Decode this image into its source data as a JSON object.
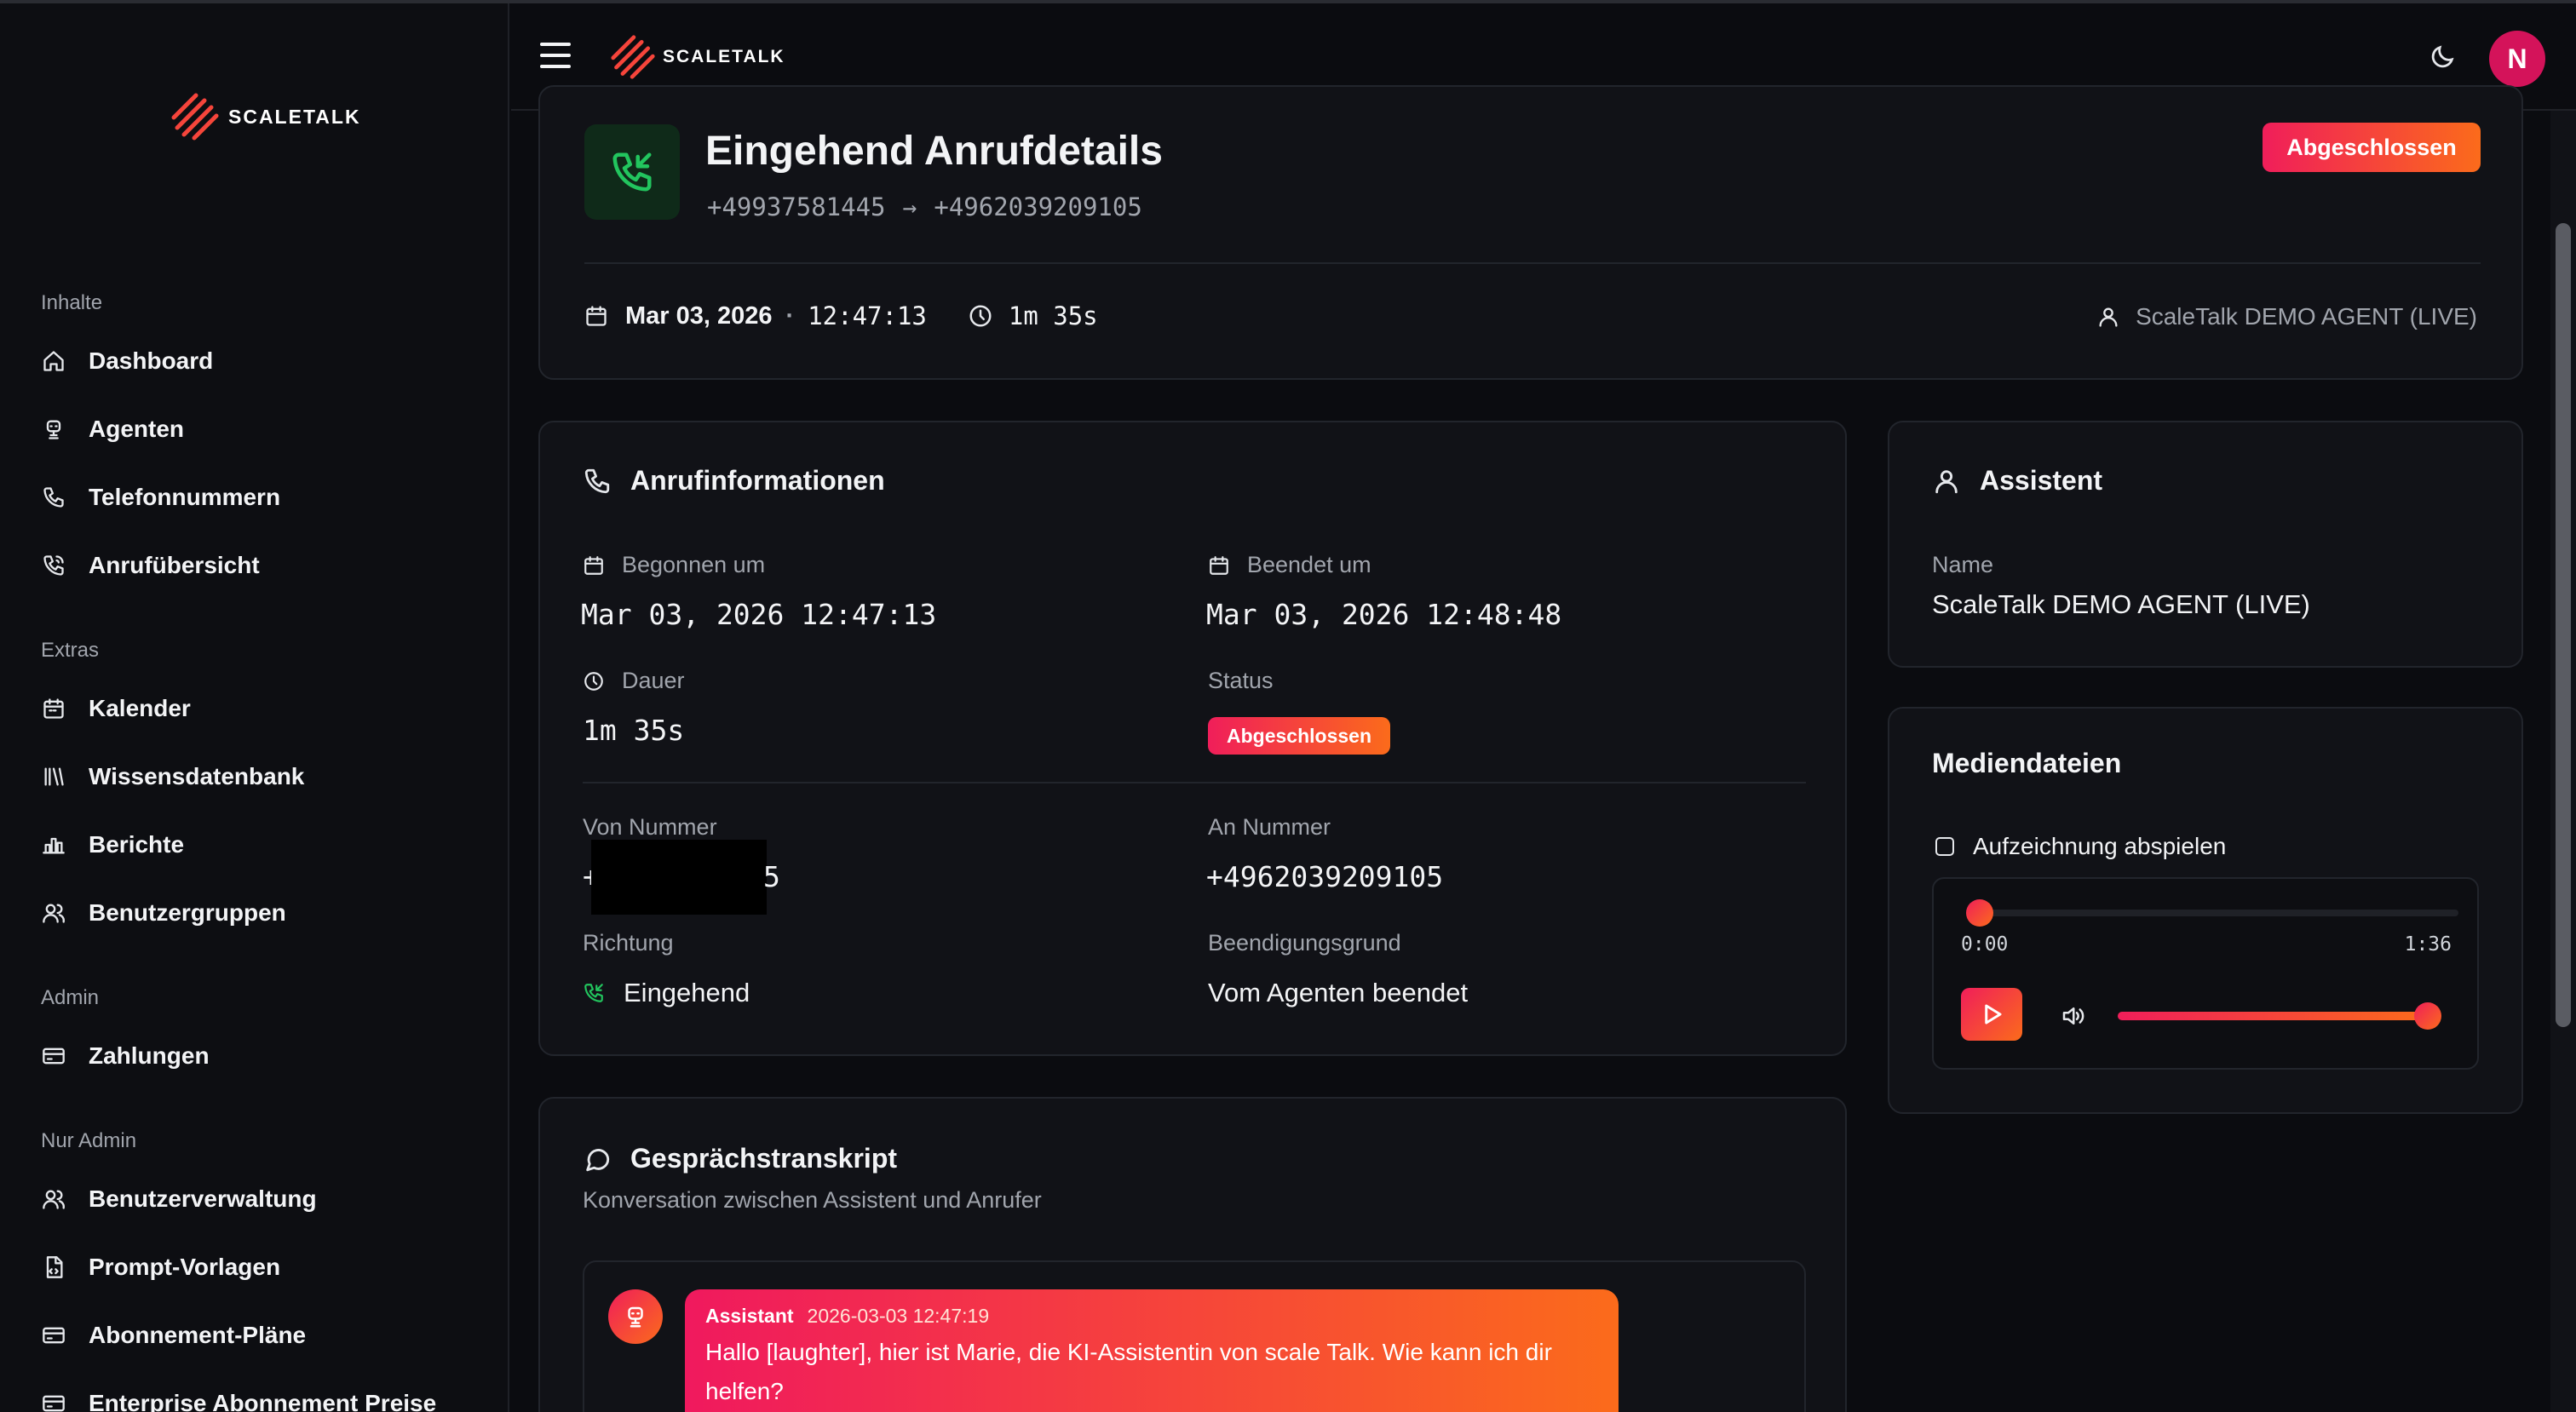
{
  "brand": {
    "name": "SCALETALK"
  },
  "sidebar": {
    "sections": [
      {
        "label": "Inhalte",
        "items": [
          "Dashboard",
          "Agenten",
          "Telefonnummern",
          "Anrufübersicht"
        ]
      },
      {
        "label": "Extras",
        "items": [
          "Kalender",
          "Wissensdatenbank",
          "Berichte",
          "Benutzergruppen"
        ]
      },
      {
        "label": "Admin",
        "items": [
          "Zahlungen"
        ]
      },
      {
        "label": "Nur Admin",
        "items": [
          "Benutzerverwaltung",
          "Prompt-Vorlagen",
          "Abonnement-Pläne",
          "Enterprise Abonnement Preise"
        ]
      }
    ]
  },
  "header": {
    "avatar_initial": "N"
  },
  "call": {
    "title": "Eingehend Anrufdetails",
    "from_number": "+49937581445",
    "to_number": "+4962039209105",
    "date": "Mar 03, 2026",
    "time": "12:47:13",
    "duration": "1m 35s",
    "agent": "ScaleTalk DEMO AGENT (LIVE)",
    "status": "Abgeschlossen"
  },
  "info": {
    "title": "Anrufinformationen",
    "started_label": "Begonnen um",
    "started_value": "Mar 03, 2026 12:47:13",
    "ended_label": "Beendet um",
    "ended_value": "Mar 03, 2026 12:48:48",
    "duration_label": "Dauer",
    "duration_value": "1m 35s",
    "status_label": "Status",
    "status_value": "Abgeschlossen",
    "from_label": "Von Nummer",
    "from_value_start": "+",
    "from_value_end": "5",
    "to_label": "An Nummer",
    "to_value": "+4962039209105",
    "direction_label": "Richtung",
    "direction_value": "Eingehend",
    "reason_label": "Beendigungsgrund",
    "reason_value": "Vom Agenten beendet"
  },
  "assistant": {
    "title": "Assistent",
    "name_label": "Name",
    "name_value": "ScaleTalk DEMO AGENT (LIVE)"
  },
  "media": {
    "title": "Mediendateien",
    "recording_label": "Aufzeichnung abspielen",
    "current_time": "0:00",
    "total_time": "1:36",
    "progress": 0.0,
    "volume": 1.0
  },
  "transcript": {
    "title": "Gesprächstranskript",
    "subtitle": "Konversation zwischen Assistent und Anrufer",
    "messages": [
      {
        "role": "Assistant",
        "time": "2026-03-03 12:47:19",
        "text": "Hallo [laughter], hier ist Marie, die KI-Assistentin von scale Talk. Wie kann ich dir helfen?"
      }
    ]
  },
  "colors": {
    "accent_start": "#f01e5a",
    "accent_end": "#fb6b1b",
    "success": "#22c55e"
  }
}
